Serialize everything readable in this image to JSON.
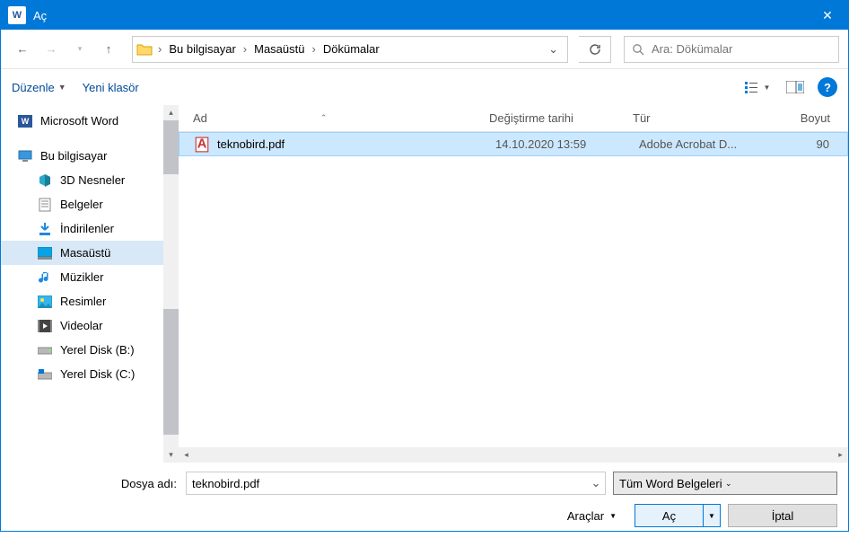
{
  "titlebar": {
    "app": "W",
    "title": "Aç"
  },
  "nav": {
    "back": "←",
    "forward": "→",
    "up": "↑"
  },
  "breadcrumb": [
    "Bu bilgisayar",
    "Masaüstü",
    "Dökümalar"
  ],
  "search": {
    "placeholder": "Ara: Dökümalar"
  },
  "toolbar": {
    "organize": "Düzenle",
    "new_folder": "Yeni klasör"
  },
  "sidebar": {
    "root": "Microsoft Word",
    "items": [
      {
        "label": "Bu bilgisayar",
        "icon": "pc"
      },
      {
        "label": "3D Nesneler",
        "icon": "3d"
      },
      {
        "label": "Belgeler",
        "icon": "docs"
      },
      {
        "label": "İndirilenler",
        "icon": "downloads"
      },
      {
        "label": "Masaüstü",
        "icon": "desktop",
        "selected": true
      },
      {
        "label": "Müzikler",
        "icon": "music"
      },
      {
        "label": "Resimler",
        "icon": "pictures"
      },
      {
        "label": "Videolar",
        "icon": "videos"
      },
      {
        "label": "Yerel Disk (B:)",
        "icon": "disk"
      },
      {
        "label": "Yerel Disk (C:)",
        "icon": "diskwin"
      }
    ]
  },
  "columns": {
    "name": "Ad",
    "mod": "Değiştirme tarihi",
    "type": "Tür",
    "size": "Boyut"
  },
  "files": [
    {
      "name": "teknobird.pdf",
      "mod": "14.10.2020 13:59",
      "type": "Adobe Acrobat D...",
      "size": "90",
      "selected": true
    }
  ],
  "bottom": {
    "filename_label": "Dosya adı:",
    "filename_value": "teknobird.pdf",
    "filter": "Tüm Word Belgeleri",
    "tools": "Araçlar",
    "open": "Aç",
    "cancel": "İptal"
  }
}
